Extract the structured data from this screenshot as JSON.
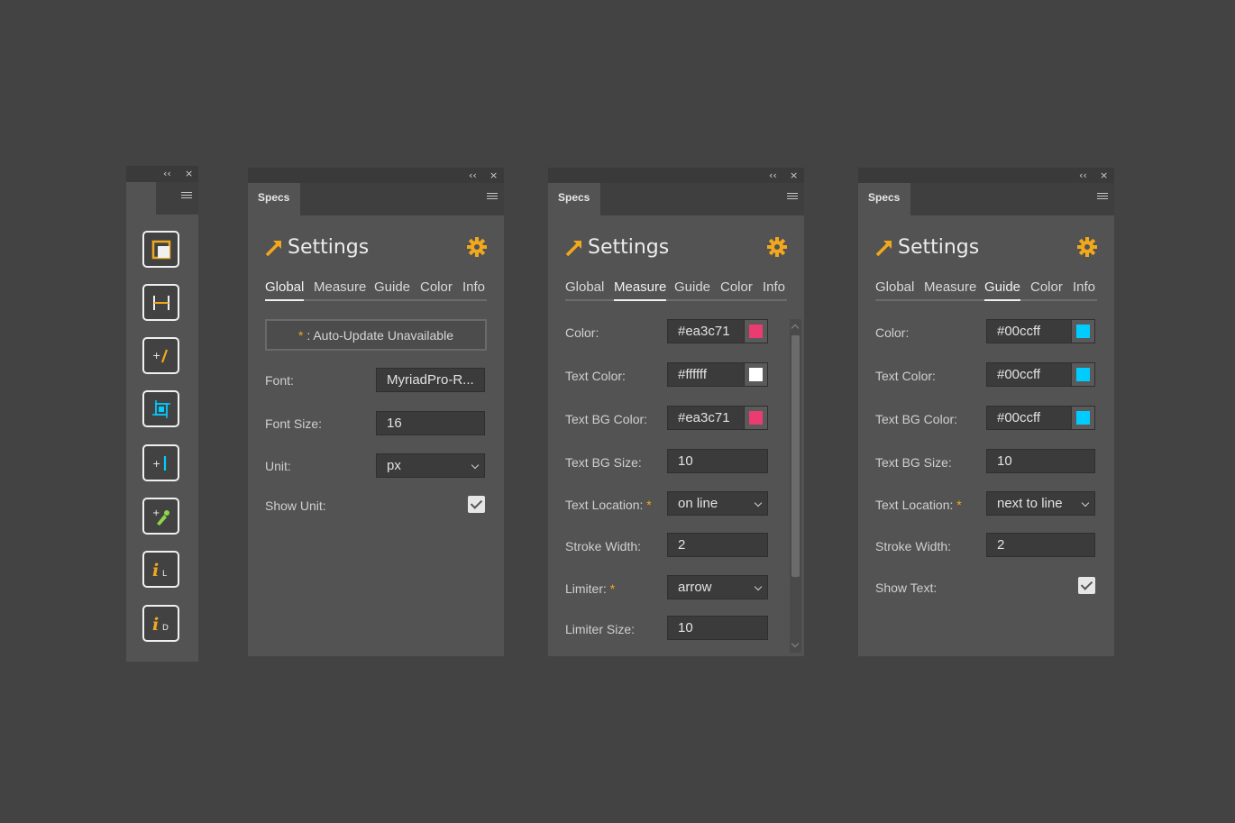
{
  "controls": {
    "collapse": "‹‹",
    "close": "×"
  },
  "panel_tab": "Specs",
  "title": "Settings",
  "nav_tabs": [
    "Global",
    "Measure",
    "Guide",
    "Color",
    "Info"
  ],
  "colors": {
    "accent": "#f2a81c",
    "measure_color": "#ea3c71",
    "guide_color": "#00ccff",
    "white": "#ffffff"
  },
  "toolbar": {
    "tools": [
      {
        "icon": "artboard-icon"
      },
      {
        "icon": "measure-width-icon"
      },
      {
        "icon": "add-guide-icon"
      },
      {
        "icon": "size-bounds-icon"
      },
      {
        "icon": "add-vertical-guide-icon"
      },
      {
        "icon": "color-picker-icon"
      },
      {
        "icon": "info-light-icon"
      },
      {
        "icon": "info-dark-icon"
      }
    ]
  },
  "global_panel": {
    "active_tab": "Global",
    "notice": {
      "star": "*",
      "text": ": Auto-Update Unavailable"
    },
    "font": {
      "label": "Font:",
      "value": "MyriadPro-R..."
    },
    "font_size": {
      "label": "Font Size:",
      "value": "16"
    },
    "unit": {
      "label": "Unit:",
      "value": "px"
    },
    "show_unit": {
      "label": "Show Unit:",
      "checked": true
    }
  },
  "measure_panel": {
    "active_tab": "Measure",
    "color": {
      "label": "Color:",
      "value": "#ea3c71"
    },
    "text_color": {
      "label": "Text Color:",
      "value": "#ffffff"
    },
    "text_bg_color": {
      "label": "Text BG Color:",
      "value": "#ea3c71"
    },
    "text_bg_size": {
      "label": "Text BG Size:",
      "value": "10"
    },
    "text_location": {
      "label": "Text Location:",
      "star": "*",
      "value": "on line"
    },
    "stroke_width": {
      "label": "Stroke Width:",
      "value": "2"
    },
    "limiter": {
      "label": "Limiter:",
      "star": "*",
      "value": "arrow"
    },
    "limiter_size": {
      "label": "Limiter Size:",
      "value": "10"
    }
  },
  "guide_panel": {
    "active_tab": "Guide",
    "color": {
      "label": "Color:",
      "value": "#00ccff"
    },
    "text_color": {
      "label": "Text Color:",
      "value": "#00ccff"
    },
    "text_bg_color": {
      "label": "Text BG Color:",
      "value": "#00ccff"
    },
    "text_bg_size": {
      "label": "Text BG Size:",
      "value": "10"
    },
    "text_location": {
      "label": "Text Location:",
      "star": "*",
      "value": "next to line"
    },
    "stroke_width": {
      "label": "Stroke Width:",
      "value": "2"
    },
    "show_text": {
      "label": "Show Text:",
      "checked": true
    }
  }
}
